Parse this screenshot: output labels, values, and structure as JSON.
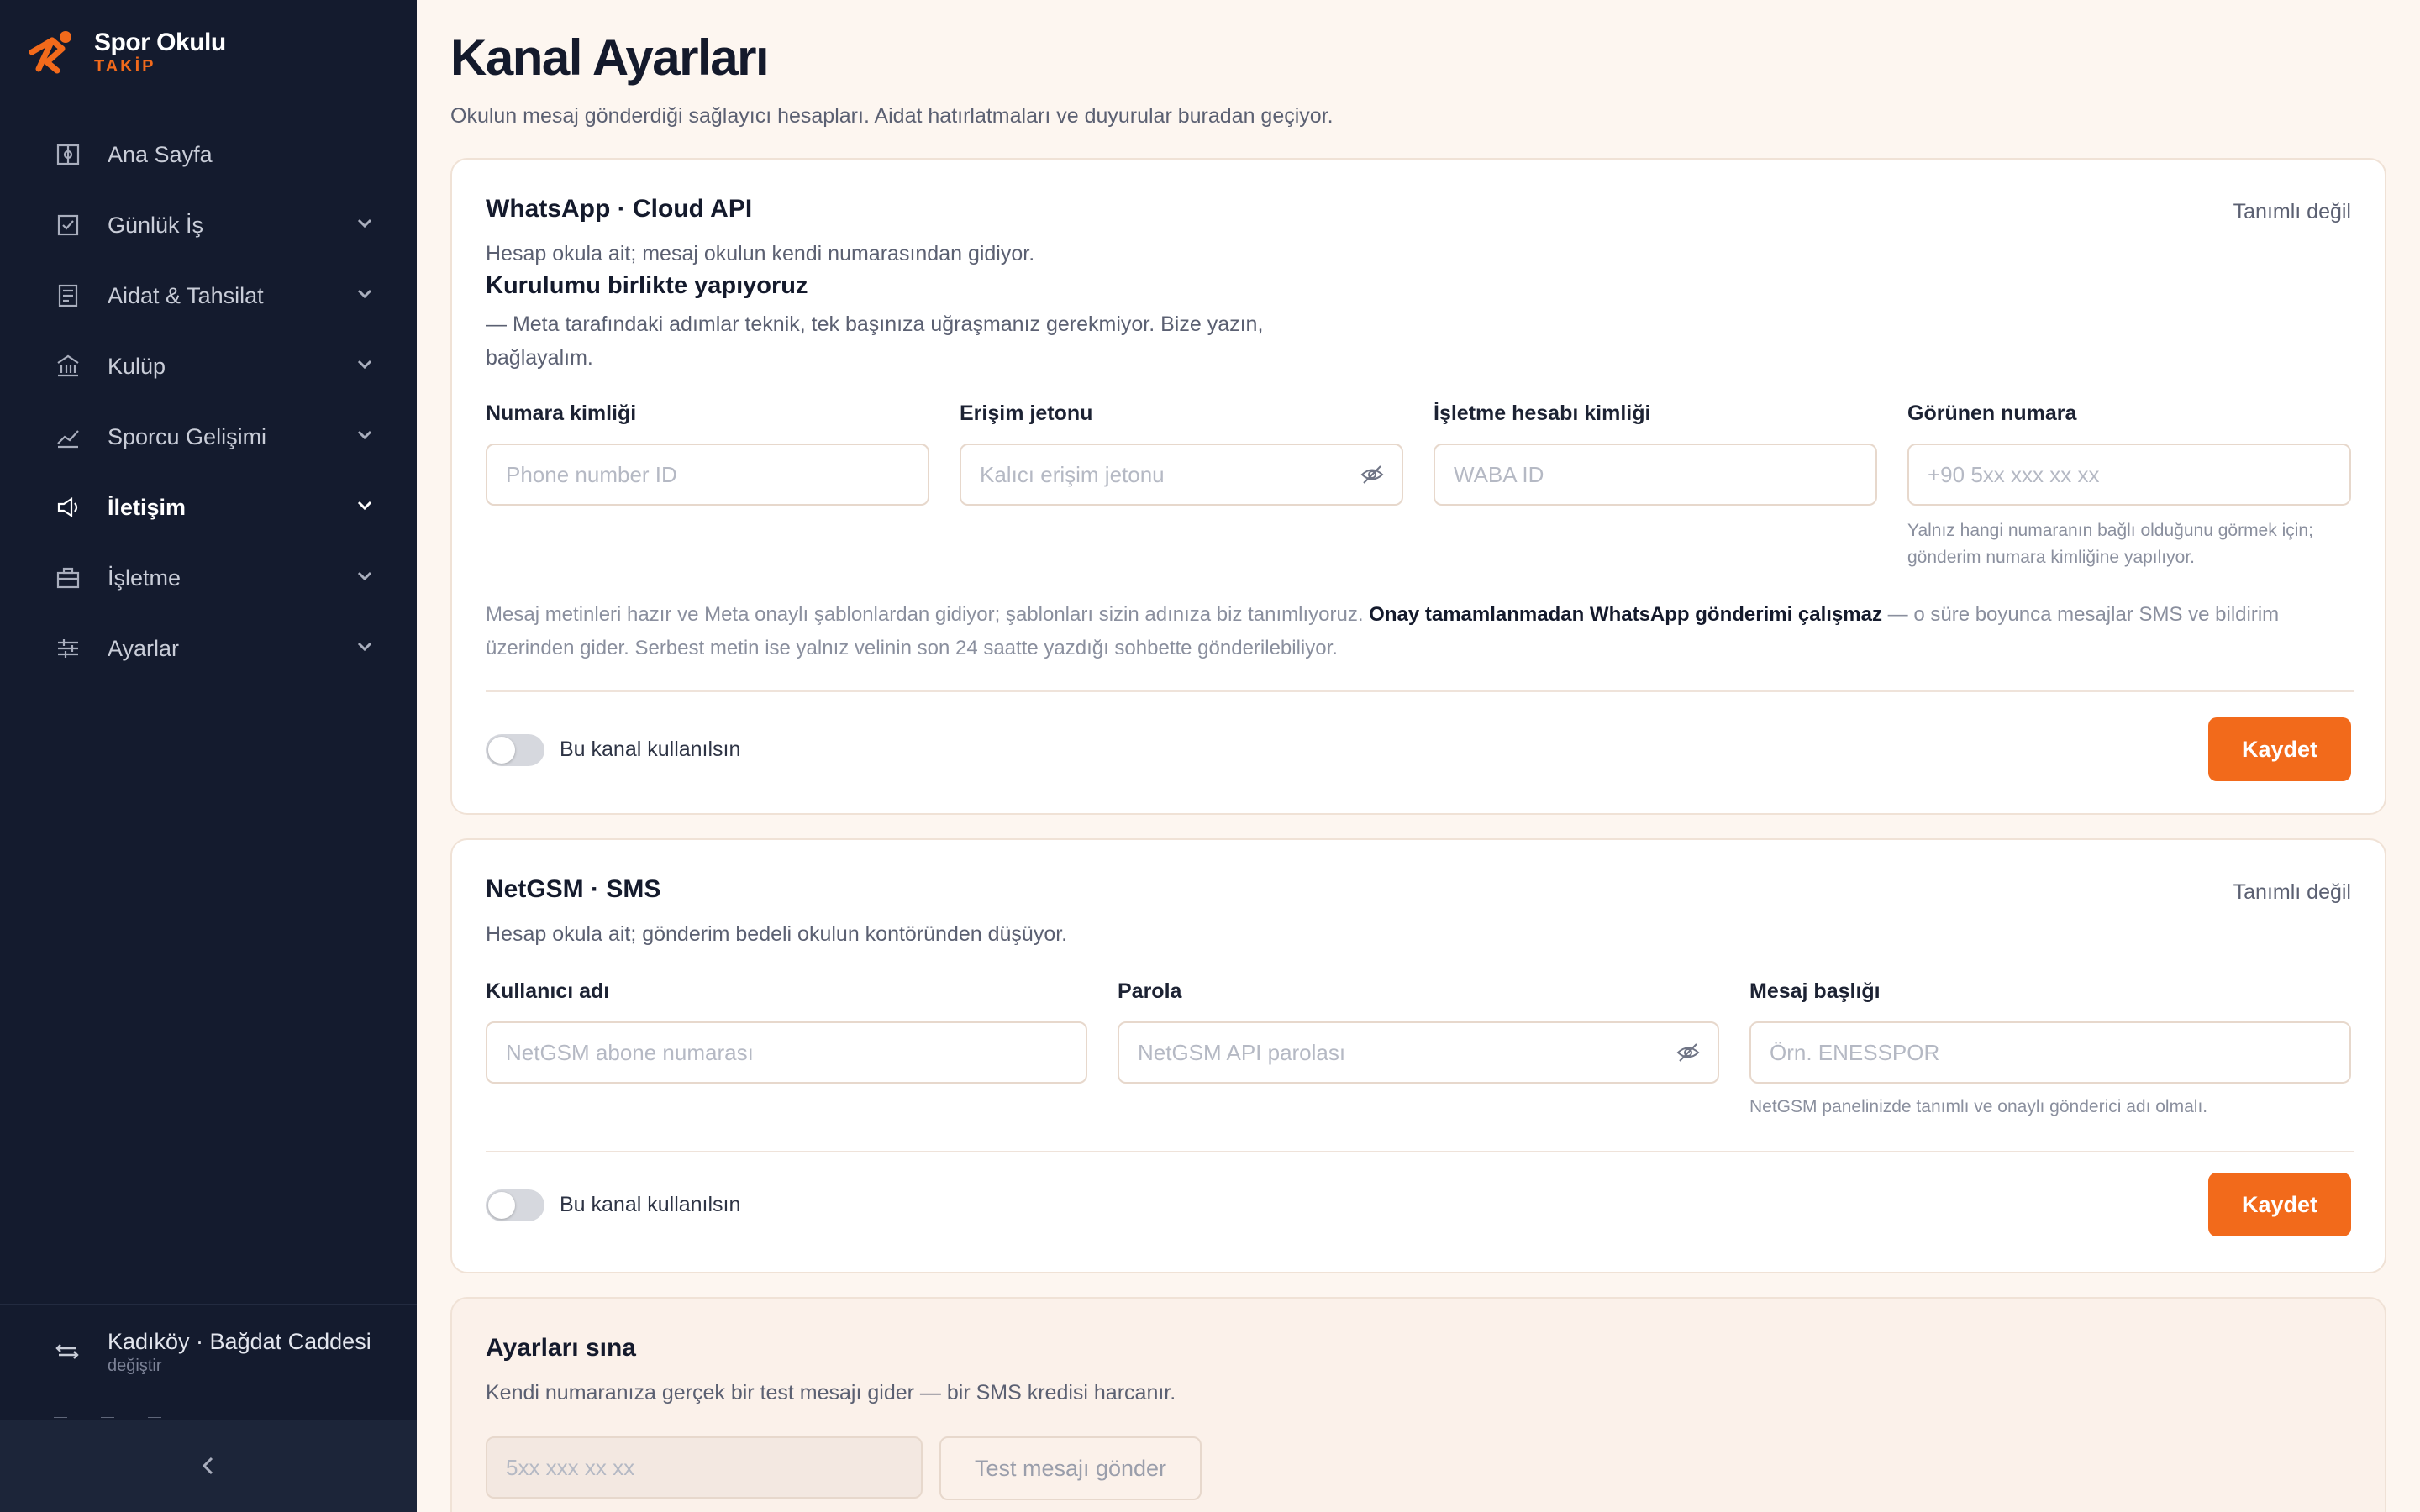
{
  "brand": {
    "name": "Spor Okulu",
    "sub": "TAKİP"
  },
  "nav": [
    {
      "label": "Ana Sayfa",
      "icon": "dashboard-icon",
      "expandable": false,
      "active": false
    },
    {
      "label": "Günlük İş",
      "icon": "checkbox-icon",
      "expandable": true,
      "active": false
    },
    {
      "label": "Aidat & Tahsilat",
      "icon": "receipt-icon",
      "expandable": true,
      "active": false
    },
    {
      "label": "Kulüp",
      "icon": "building-icon",
      "expandable": true,
      "active": false
    },
    {
      "label": "Sporcu Gelişimi",
      "icon": "chart-line-icon",
      "expandable": true,
      "active": false
    },
    {
      "label": "İletişim",
      "icon": "megaphone-icon",
      "expandable": true,
      "active": true
    },
    {
      "label": "İşletme",
      "icon": "briefcase-icon",
      "expandable": true,
      "active": false
    },
    {
      "label": "Ayarlar",
      "icon": "sliders-icon",
      "expandable": true,
      "active": false
    }
  ],
  "branch": {
    "name": "Kadıköy · Bağdat Caddesi",
    "action": "değiştir"
  },
  "page": {
    "title": "Kanal Ayarları",
    "description": "Okulun mesaj gönderdiği sağlayıcı hesapları. Aidat hatırlatmaları ve duyurular buradan geçiyor."
  },
  "whatsapp": {
    "title": "WhatsApp · Cloud API",
    "status": "Tanımlı değil",
    "desc": "Hesap okula ait; mesaj okulun kendi numarasından gidiyor.",
    "setup_title": "Kurulumu birlikte yapıyoruz",
    "setup_line1": "— Meta tarafındaki adımlar teknik, tek başınıza uğraşmanız gerekmiyor. Bize yazın,",
    "setup_line2": "bağlayalım.",
    "fields": {
      "phone_id": {
        "label": "Numara kimliği",
        "placeholder": "Phone number ID"
      },
      "token": {
        "label": "Erişim jetonu",
        "placeholder": "Kalıcı erişim jetonu"
      },
      "waba": {
        "label": "İşletme hesabı kimliği",
        "placeholder": "WABA ID"
      },
      "display": {
        "label": "Görünen numara",
        "placeholder": "+90 5xx xxx xx xx"
      }
    },
    "display_hint_1": "Yalnız hangi numaranın bağlı olduğunu görmek için;",
    "display_hint_2": "gönderim numara kimliğine yapılıyor.",
    "note_part1": "Mesaj metinleri hazır ve Meta onaylı şablonlardan gidiyor; şablonları sizin adınıza biz tanımlıyoruz.",
    "note_bold": "Onay tamamlanmadan WhatsApp gönderimi çalışmaz",
    "note_part2": "— o süre boyunca mesajlar SMS ve bildirim",
    "note_line2": "üzerinden gider. Serbest metin ise yalnız velinin son 24 saatte yazdığı sohbette gönderilebiliyor.",
    "toggle_label": "Bu kanal kullanılsın",
    "save": "Kaydet"
  },
  "netgsm": {
    "title": "NetGSM · SMS",
    "status": "Tanımlı değil",
    "desc": "Hesap okula ait; gönderim bedeli okulun kontöründen düşüyor.",
    "fields": {
      "username": {
        "label": "Kullanıcı adı",
        "placeholder": "NetGSM abone numarası"
      },
      "password": {
        "label": "Parola",
        "placeholder": "NetGSM API parolası"
      },
      "header": {
        "label": "Mesaj başlığı",
        "placeholder": "Örn. ENESSPOR"
      }
    },
    "header_hint": "NetGSM panelinizde tanımlı ve onaylı gönderici adı olmalı.",
    "toggle_label": "Bu kanal kullanılsın",
    "save": "Kaydet"
  },
  "test": {
    "title": "Ayarları sına",
    "desc": "Kendi numaranıza gerçek bir test mesajı gider — bir SMS kredisi harcanır.",
    "phone_placeholder": "5xx xxx xx xx",
    "send": "Test mesajı gönder"
  },
  "colors": {
    "accent": "#f26a1b",
    "sidebar": "#141b2e",
    "page_bg": "#fdf6f0"
  }
}
